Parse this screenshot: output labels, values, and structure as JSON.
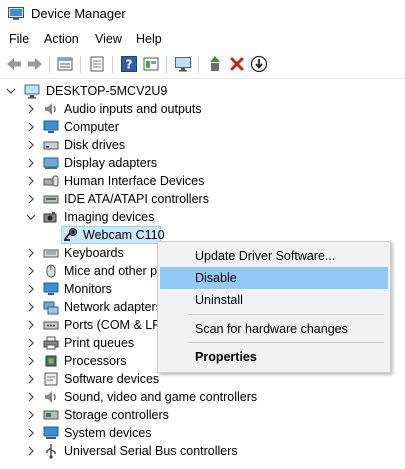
{
  "window": {
    "title": "Device Manager"
  },
  "menu": [
    "File",
    "Action",
    "View",
    "Help"
  ],
  "toolbar": [
    "back-icon",
    "forward-icon",
    "properties-icon",
    "sheet-icon",
    "help-icon",
    "panel-icon",
    "monitor-scan-icon",
    "update-driver-icon",
    "uninstall-icon",
    "disable-device-icon"
  ],
  "tree": {
    "root": "DESKTOP-5MCV2U9",
    "categories": [
      "Audio inputs and outputs",
      "Computer",
      "Disk drives",
      "Display adapters",
      "Human Interface Devices",
      "IDE ATA/ATAPI controllers",
      "Imaging devices",
      "Keyboards",
      "Mice and other pointing devices",
      "Monitors",
      "Network adapters",
      "Ports (COM & LPT)",
      "Print queues",
      "Processors",
      "Software devices",
      "Sound, video and game controllers",
      "Storage controllers",
      "System devices",
      "Universal Serial Bus controllers"
    ],
    "selected_device": "Webcam C110"
  },
  "context_menu": {
    "update": "Update Driver Software...",
    "disable": "Disable",
    "uninstall": "Uninstall",
    "scan": "Scan for hardware changes",
    "properties": "Properties"
  },
  "colors": {
    "selection": "#cce8ff",
    "menu_highlight": "#91c9f7",
    "menu_bg": "#f2f2f2"
  }
}
